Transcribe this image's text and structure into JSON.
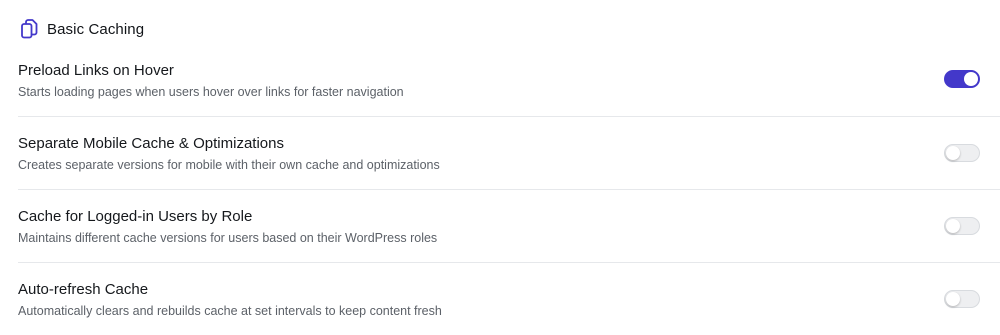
{
  "section": {
    "title": "Basic Caching",
    "icon": "copy-icon",
    "accent_color": "#4338ca"
  },
  "settings": [
    {
      "title": "Preload Links on Hover",
      "description": "Starts loading pages when users hover over links for faster navigation",
      "enabled": true
    },
    {
      "title": "Separate Mobile Cache & Optimizations",
      "description": "Creates separate versions for mobile with their own cache and optimizations",
      "enabled": false
    },
    {
      "title": "Cache for Logged-in Users by Role",
      "description": "Maintains different cache versions for users based on their WordPress roles",
      "enabled": false
    },
    {
      "title": "Auto-refresh Cache",
      "description": "Automatically clears and rebuilds cache at set intervals to keep content fresh",
      "enabled": false
    }
  ]
}
